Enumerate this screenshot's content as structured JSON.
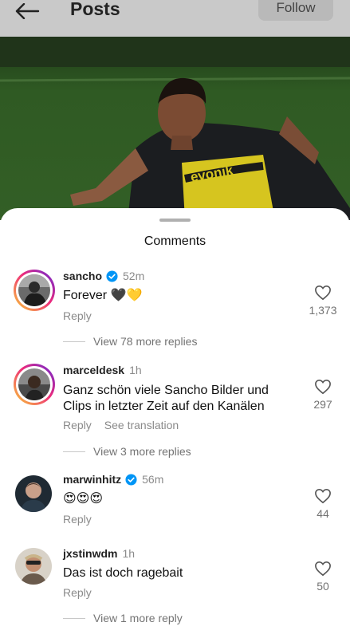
{
  "header": {
    "title": "Posts",
    "follow_label": "Follow",
    "back_icon": "arrow-left-icon"
  },
  "sheet": {
    "title": "Comments"
  },
  "comments": [
    {
      "username": "sancho",
      "verified": true,
      "time": "52m",
      "text": "Forever 🖤💛",
      "reply_label": "Reply",
      "likes": "1,373",
      "view_replies": "View 78 more replies"
    },
    {
      "username": "marceldesk",
      "verified": false,
      "time": "1h",
      "text_line1": "Ganz schön viele Sancho Bilder und",
      "text_line2": "Clips in letzter Zeit auf den Kanälen",
      "reply_label": "Reply",
      "translate_label": "See translation",
      "likes": "297",
      "view_replies": "View 3 more replies"
    },
    {
      "username": "marwinhitz",
      "verified": true,
      "time": "56m",
      "text": "😍😍😍",
      "reply_label": "Reply",
      "likes": "44"
    },
    {
      "username": "jxstinwdm",
      "verified": false,
      "time": "1h",
      "text": "Das ist doch ragebait",
      "reply_label": "Reply",
      "likes": "50",
      "view_replies": "View 1 more reply"
    }
  ],
  "colors": {
    "verified_blue": "#0095f6",
    "jersey_yellow": "#f2d500"
  }
}
